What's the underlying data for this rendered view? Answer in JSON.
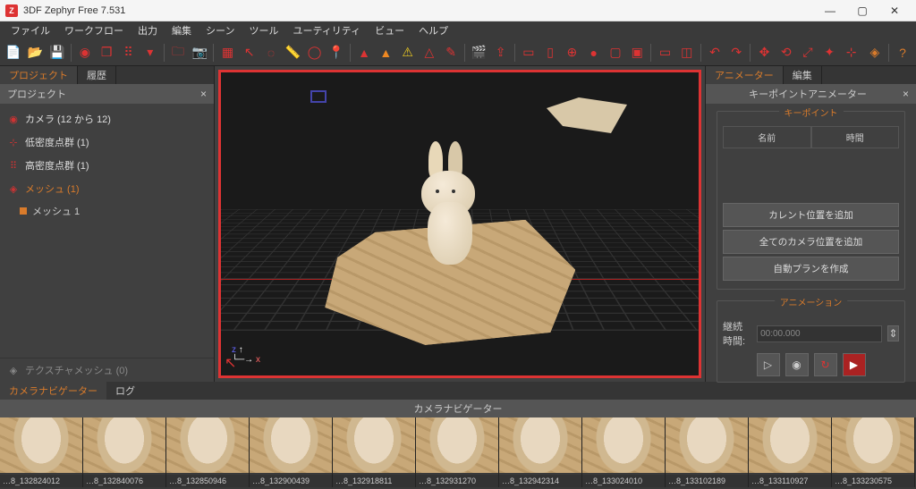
{
  "window": {
    "title": "3DF Zephyr Free 7.531",
    "min": "—",
    "max": "▢",
    "close": "✕"
  },
  "menu": {
    "file": "ファイル",
    "workflow": "ワークフロー",
    "export": "出力",
    "edit": "編集",
    "scene": "シーン",
    "tool": "ツール",
    "utility": "ユーティリティ",
    "view": "ビュー",
    "help": "ヘルプ"
  },
  "left": {
    "tab_project": "プロジェクト",
    "tab_history": "履歴",
    "panel_title": "プロジェクト",
    "items": {
      "cameras": "カメラ (12 から 12)",
      "sparse": "低密度点群 (1)",
      "dense": "高密度点群 (1)",
      "mesh": "メッシュ (1)",
      "mesh_child": "メッシュ 1",
      "tex_mesh": "テクスチャメッシュ (0)"
    }
  },
  "viewport": {
    "axis_z": "z",
    "axis_x": "x"
  },
  "right": {
    "tab_animator": "アニメーター",
    "tab_edit": "編集",
    "panel_title": "キーポイントアニメーター",
    "kp_group": "キーポイント",
    "col_name": "名前",
    "col_time": "時間",
    "btn_add_current": "カレント位置を追加",
    "btn_add_all": "全てのカメラ位置を追加",
    "btn_autoplan": "自動プランを作成",
    "anim_group": "アニメーション",
    "duration_label": "継続時間:",
    "duration_value": "00:00.000"
  },
  "bottom": {
    "tab_camnav": "カメラナビゲーター",
    "tab_log": "ログ",
    "header": "カメラナビゲーター",
    "thumbs": [
      "…8_132824012",
      "…8_132840076",
      "…8_132850946",
      "…8_132900439",
      "…8_132918811",
      "…8_132931270",
      "…8_132942314",
      "…8_133024010",
      "…8_133102189",
      "…8_133110927",
      "…8_133230575"
    ]
  }
}
